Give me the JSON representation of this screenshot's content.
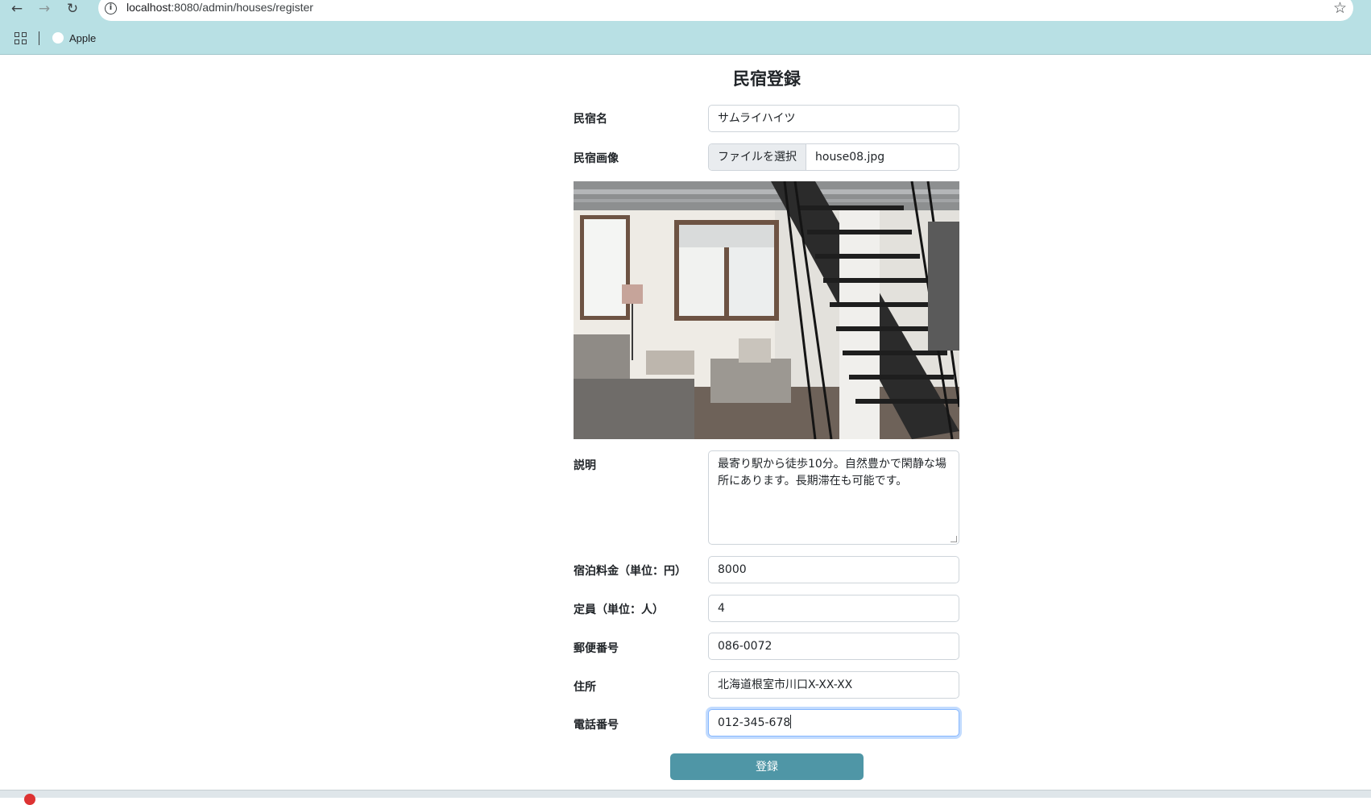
{
  "browser": {
    "url_host": "localhost",
    "url_path": ":8080/admin/houses/register",
    "bookmarks": [
      {
        "label": "Apple"
      }
    ]
  },
  "page": {
    "title": "民宿登録"
  },
  "form": {
    "name": {
      "label": "民宿名",
      "value": "サムライハイツ"
    },
    "image": {
      "label": "民宿画像",
      "button": "ファイルを選択",
      "filename": "house08.jpg"
    },
    "description": {
      "label": "説明",
      "value": "最寄り駅から徒歩10分。自然豊かで閑静な場所にあります。長期滞在も可能です。"
    },
    "price": {
      "label": "宿泊料金（単位：円）",
      "value": "8000"
    },
    "capacity": {
      "label": "定員（単位：人）",
      "value": "4"
    },
    "postal_code": {
      "label": "郵便番号",
      "value": "086-0072"
    },
    "address": {
      "label": "住所",
      "value": "北海道根室市川口X-XX-XX"
    },
    "phone": {
      "label": "電話番号",
      "value": "012-345-678"
    },
    "submit_label": "登録"
  },
  "icons": {
    "back": "back-arrow-icon",
    "forward": "forward-arrow-icon",
    "reload": "reload-icon",
    "info": "site-info-icon",
    "star": "bookmark-star-icon",
    "apps": "apps-grid-icon",
    "apple": "apple-icon"
  },
  "colors": {
    "chrome_bg": "#b8e0e4",
    "submit_bg": "#4f96a6"
  }
}
